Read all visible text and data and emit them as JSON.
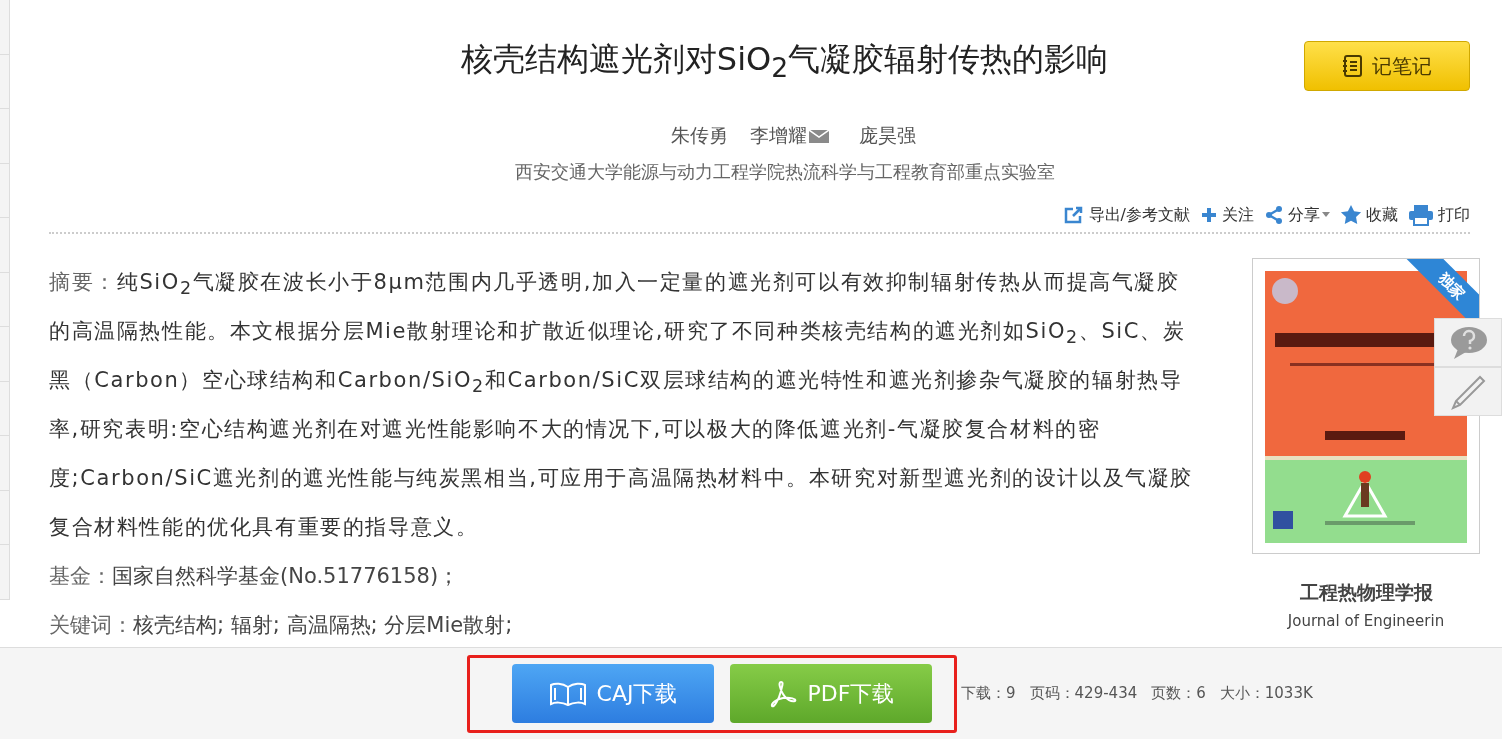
{
  "title": "核壳结构遮光剂对SiO$_{2}$气凝胶辐射传热的影响",
  "note_button": "记笔记",
  "authors": [
    {
      "name": "朱传勇",
      "email": false
    },
    {
      "name": "李增耀",
      "email": true
    },
    {
      "name": "庞昊强",
      "email": false
    }
  ],
  "affiliation": "西安交通大学能源与动力工程学院热流科学与工程教育部重点实验室",
  "toolbar": [
    {
      "label": "导出/参考文献",
      "dropdown": false
    },
    {
      "label": "关注",
      "dropdown": false
    },
    {
      "label": "分享",
      "dropdown": true
    },
    {
      "label": "收藏",
      "dropdown": false
    },
    {
      "label": "打印",
      "dropdown": false
    }
  ],
  "abstract": {
    "label": "摘要：",
    "text": "纯SiO$_{2}$气凝胶在波长小于8μm范围内几乎透明,加入一定量的遮光剂可以有效抑制辐射传热从而提高气凝胶的高温隔热性能。本文根据分层Mie散射理论和扩散近似理论,研究了不同种类核壳结构的遮光剂如SiO$_{2}$、SiC、炭黑（Carbon）空心球结构和Carbon/SiO$_{2}$和Carbon/SiC双层球结构的遮光特性和遮光剂掺杂气凝胶的辐射热导率,研究表明:空心结构遮光剂在对遮光性能影响不大的情况下,可以极大的降低遮光剂-气凝胶复合材料的密度;Carbon/SiC遮光剂的遮光性能与纯炭黑相当,可应用于高温隔热材料中。本研究对新型遮光剂的设计以及气凝胶复合材料性能的优化具有重要的指导意义。"
  },
  "fund": {
    "label": "基金：",
    "text": "国家自然科学基金(No.51776158)；"
  },
  "keywords": {
    "label": "关键词：",
    "items": [
      "核壳结构;",
      "辐射;",
      "高温隔热;",
      "分层Mie散射;"
    ]
  },
  "journal": {
    "badge": "独家",
    "name": "工程热物理学报",
    "english_name": "Journal of Engineerin"
  },
  "side_tools": [
    {
      "kind": "question"
    },
    {
      "kind": "edit"
    }
  ],
  "downloads": [
    {
      "label": "CAJ下载",
      "kind": "caj"
    },
    {
      "label": "PDF下载",
      "kind": "pdf"
    }
  ],
  "stats": [
    {
      "label": "下载：",
      "value": "9"
    },
    {
      "label": "页码：",
      "value": "429-434"
    },
    {
      "label": "页数：",
      "value": "6"
    },
    {
      "label": "大小：",
      "value": "1033K"
    }
  ]
}
